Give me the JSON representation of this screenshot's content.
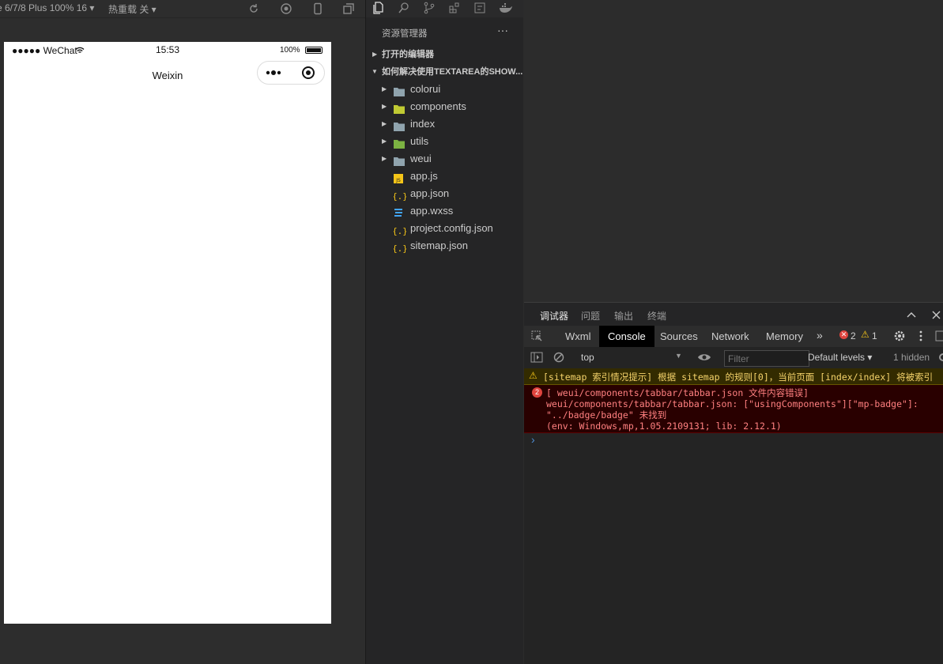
{
  "simulator": {
    "device_label": "e 6/7/8 Plus 100% 16",
    "hot_reload_label": "热重载 关",
    "status_carrier": "●●●●● WeChat",
    "status_time": "15:53",
    "status_battery": "100%",
    "nav_title": "Weixin"
  },
  "explorer": {
    "title": "资源管理器",
    "more": "···",
    "open_editors": "打开的编辑器",
    "project": "如何解决使用TEXTAREA的SHOW...",
    "items": [
      {
        "label": "colorui",
        "type": "folder"
      },
      {
        "label": "components",
        "type": "folder"
      },
      {
        "label": "index",
        "type": "folder"
      },
      {
        "label": "utils",
        "type": "folder"
      },
      {
        "label": "weui",
        "type": "folder"
      },
      {
        "label": "app.js",
        "type": "js"
      },
      {
        "label": "app.json",
        "type": "json"
      },
      {
        "label": "app.wxss",
        "type": "css"
      },
      {
        "label": "project.config.json",
        "type": "json"
      },
      {
        "label": "sitemap.json",
        "type": "json"
      }
    ]
  },
  "devtools": {
    "tabs": [
      "调试器",
      "问题",
      "输出",
      "终端"
    ],
    "tool_tabs": [
      "Wxml",
      "Console",
      "Sources",
      "Network",
      "Memory"
    ],
    "more_tabs": "»",
    "error_count": "2",
    "warning_count": "1",
    "context": "top",
    "filter_placeholder": "Filter",
    "levels": "Default levels",
    "hidden": "1 hidden",
    "warning_message": "[sitemap 索引情况提示] 根据 sitemap 的规则[0]，当前页面 [index/index] 将被索引",
    "error_badge": "2",
    "error_lines": [
      "[ weui/components/tabbar/tabbar.json 文件内容错误]",
      "weui/components/tabbar/tabbar.json: [\"usingComponents\"][\"mp-badge\"]:",
      "\"../badge/badge\" 未找到",
      "(env: Windows,mp,1.05.2109131; lib: 2.12.1)"
    ],
    "prompt": "›"
  }
}
